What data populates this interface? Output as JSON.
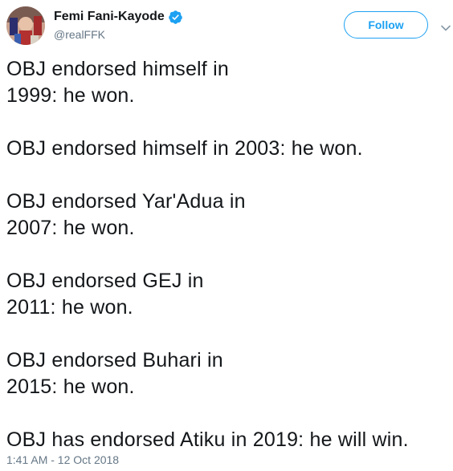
{
  "author": {
    "display_name": "Femi Fani-Kayode",
    "handle": "@realFFK",
    "verified": true
  },
  "actions": {
    "follow_label": "Follow"
  },
  "tweet": {
    "lines": [
      "OBJ endorsed himself in",
      "1999: he won.",
      "",
      "OBJ endorsed himself in 2003: he won.",
      "",
      "OBJ endorsed Yar'Adua in",
      "2007: he won.",
      "",
      "OBJ endorsed GEJ in",
      "2011: he won.",
      "",
      "OBJ endorsed Buhari in",
      "2015: he won.",
      "",
      "OBJ has endorsed Atiku in 2019: he will win."
    ],
    "timestamp": "1:41 AM - 12 Oct 2018"
  },
  "colors": {
    "accent": "#1da1f2",
    "text": "#14171a",
    "muted": "#657786"
  },
  "icons": {
    "verified": "verified-badge-icon",
    "more": "chevron-down-icon"
  }
}
